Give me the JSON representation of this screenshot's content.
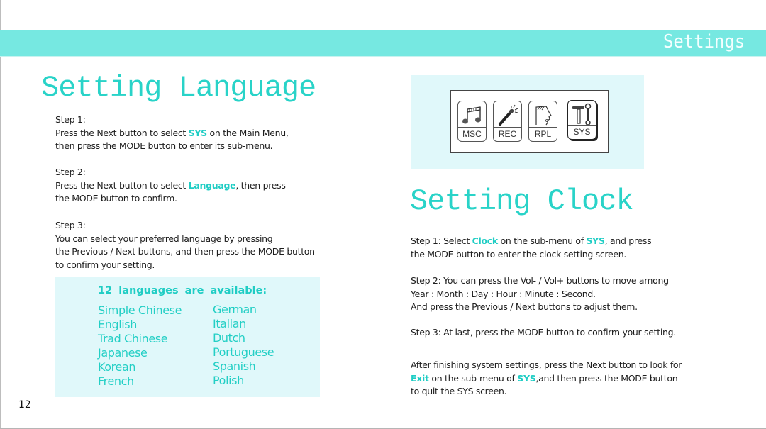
{
  "header": {
    "title": "Settings"
  },
  "colors": {
    "accent": "#1fcdc4",
    "header_band": "#76e8e1",
    "panel_bg": "#e0f8fa"
  },
  "language_section": {
    "title": "Setting Language",
    "steps": [
      {
        "label": "Step 1:",
        "lines": [
          [
            "Press the Next button to select ",
            {
              "hl": "SYS"
            },
            " on the Main Menu,"
          ],
          [
            "then press the MODE button to enter its sub-menu."
          ]
        ]
      },
      {
        "label": "Step 2:",
        "lines": [
          [
            "Press the Next button to select ",
            {
              "hl": "Language"
            },
            ", then press"
          ],
          [
            "the MODE button to confirm."
          ]
        ]
      },
      {
        "label": "Step 3:",
        "lines": [
          [
            "You can select your preferred language by pressing"
          ],
          [
            "the Previous / Next buttons, and then press the MODE button"
          ],
          [
            "to confirm your setting."
          ]
        ]
      }
    ],
    "languages_box": {
      "title": "12 languages are available:",
      "column_1": [
        "Simple Chinese",
        "English",
        "Trad Chinese",
        "Japanese",
        "Korean",
        "French"
      ],
      "column_2": [
        "German",
        "Italian",
        "Dutch",
        "Portuguese",
        "Spanish",
        "Polish"
      ]
    }
  },
  "main_menu": {
    "icons": [
      {
        "id": "msc",
        "label": "MSC",
        "icon": "music-notes-icon",
        "selected": false
      },
      {
        "id": "rec",
        "label": "REC",
        "icon": "microphone-icon",
        "selected": false
      },
      {
        "id": "rpl",
        "label": "RPL",
        "icon": "speaking-head-icon",
        "selected": false
      },
      {
        "id": "sys",
        "label": "SYS",
        "icon": "hammer-wrench-icon",
        "selected": true
      }
    ]
  },
  "clock_section": {
    "title": "Setting Clock",
    "paragraphs": [
      {
        "lines": [
          [
            "Step 1: Select ",
            {
              "hl": "Clock"
            },
            " on the sub-menu of ",
            {
              "hl": "SYS"
            },
            ", and press"
          ],
          [
            "the MODE button to enter the clock setting screen."
          ]
        ]
      },
      {
        "lines": [
          [
            "Step 2: You can press the Vol- / Vol+ buttons to move among"
          ],
          [
            "Year : Month : Day : Hour : Minute : Second."
          ],
          [
            "And press the Previous / Next buttons to adjust them."
          ]
        ]
      },
      {
        "lines": [
          [
            "Step 3: At last, press the MODE button to confirm your setting."
          ]
        ]
      },
      {
        "lines": [
          [
            "After finishing system settings, press the Next button to look for"
          ],
          [
            {
              "hl": "Exit"
            },
            " on the sub-menu of ",
            {
              "hl": "SYS"
            },
            ",and then press the MODE button"
          ],
          [
            "to quit the SYS screen."
          ]
        ]
      }
    ]
  },
  "page_number": "12"
}
